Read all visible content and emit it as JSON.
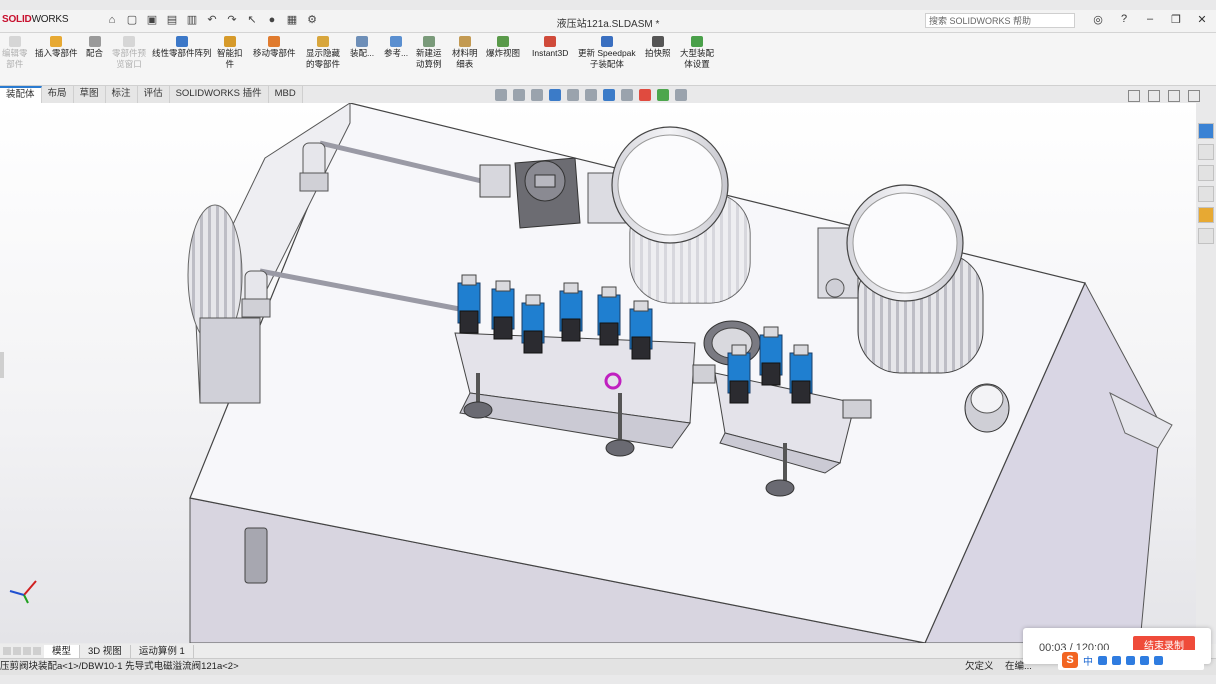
{
  "app": {
    "logo_brand": "SOLID",
    "logo_rest": "WORKS",
    "document_title": "液压站121a.SLDASM *",
    "help_search_placeholder": "搜索 SOLIDWORKS 帮助"
  },
  "ribbon": {
    "buttons": [
      {
        "label": "编辑零\n部件",
        "icon": "edit-component-icon",
        "color": "#8aa5c8",
        "enabled": false
      },
      {
        "label": "插入零部件",
        "icon": "insert-component-icon",
        "color": "#e7a933",
        "enabled": true
      },
      {
        "label": "配合",
        "icon": "mate-icon",
        "color": "#9a9a9a",
        "enabled": true
      },
      {
        "label": "零部件预\n览窗口",
        "icon": "preview-window-icon",
        "color": "#bbbbbb",
        "enabled": false
      },
      {
        "label": "线性零部件阵列",
        "icon": "linear-pattern-icon",
        "color": "#3c78c8",
        "enabled": true
      },
      {
        "label": "智能扣\n件",
        "icon": "smart-fastener-icon",
        "color": "#d69a2a",
        "enabled": true
      },
      {
        "label": "移动零部件",
        "icon": "move-component-icon",
        "color": "#e07b2e",
        "enabled": true
      },
      {
        "label": "显示隐藏\n的零部件",
        "icon": "show-hidden-icon",
        "color": "#d8a63c",
        "enabled": true
      },
      {
        "label": "装配...",
        "icon": "assembly-features-icon",
        "color": "#6e8fb8",
        "enabled": true
      },
      {
        "label": "参考...",
        "icon": "reference-geometry-icon",
        "color": "#5a8fd0",
        "enabled": true
      },
      {
        "label": "新建运\n动算例",
        "icon": "new-motion-study-icon",
        "color": "#7a9a7a",
        "enabled": true
      },
      {
        "label": "材料明\n细表",
        "icon": "bom-icon",
        "color": "#c39a52",
        "enabled": true
      },
      {
        "label": "爆炸视图",
        "icon": "exploded-view-icon",
        "color": "#5a9a4a",
        "enabled": true
      },
      {
        "label": "Instant3D",
        "icon": "instant3d-icon",
        "color": "#d04a3a",
        "enabled": true
      },
      {
        "label": "更新 Speedpak\n子装配体",
        "icon": "speedpak-icon",
        "color": "#3a6fc0",
        "enabled": true
      },
      {
        "label": "拍快照",
        "icon": "snapshot-icon",
        "color": "#555555",
        "enabled": true
      },
      {
        "label": "大型装配\n体设置",
        "icon": "large-assembly-icon",
        "color": "#4aa04a",
        "enabled": true
      }
    ]
  },
  "command_tabs": [
    "装配体",
    "布局",
    "草图",
    "标注",
    "评估",
    "SOLIDWORKS 插件",
    "MBD"
  ],
  "bottom_tabs": [
    "模型",
    "3D 视图",
    "运动算例 1"
  ],
  "status": {
    "path": "压剪阀块装配a<1>/DBW10-1 先导式电磁溢流阀121a<2>",
    "definition": "欠定义",
    "mode": "在编..."
  },
  "recorder": {
    "time": "00:03 / 120:00",
    "button": "结束录制"
  },
  "ime": {
    "logo": "S",
    "lang": "中"
  },
  "colors": {
    "valve_blue": "#1f7fd0",
    "manifold": "#e4e3ea",
    "tank_top": "#f6f6f9",
    "motor": "#e9e9ee"
  }
}
